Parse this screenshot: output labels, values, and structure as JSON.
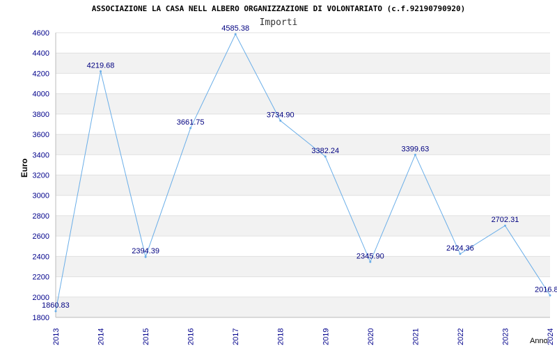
{
  "chart_data": {
    "type": "line",
    "title": "ASSOCIAZIONE LA CASA NELL ALBERO ORGANIZZAZIONE DI VOLONTARIATO (c.f.92190790920)",
    "subtitle": "Importi",
    "xlabel": "Anno",
    "ylabel": "Euro",
    "ylim": [
      1800,
      4600
    ],
    "yticks": [
      1800,
      2000,
      2200,
      2400,
      2600,
      2800,
      3000,
      3200,
      3400,
      3600,
      3800,
      4000,
      4200,
      4400,
      4600
    ],
    "categories": [
      "2013",
      "2014",
      "2015",
      "2016",
      "2017",
      "2018",
      "2019",
      "2020",
      "2021",
      "2022",
      "2023",
      "2024"
    ],
    "values": [
      1860.83,
      4219.68,
      2394.39,
      3661.75,
      4585.38,
      3734.9,
      3382.24,
      2345.9,
      3399.63,
      2424.36,
      2702.31,
      2016.8
    ],
    "value_labels": [
      "1860.83",
      "4219.68",
      "2394.39",
      "3661.75",
      "4585.38",
      "3734.90",
      "3382.24",
      "2345.90",
      "3399.63",
      "2424.36",
      "2702.31",
      "2016.8"
    ],
    "grid": true,
    "colors": {
      "line": "#6aaee8",
      "tick_text": "#00008b",
      "label_text": "#000080",
      "band": "#f2f2f2",
      "grid": "#e0e0e0"
    }
  }
}
